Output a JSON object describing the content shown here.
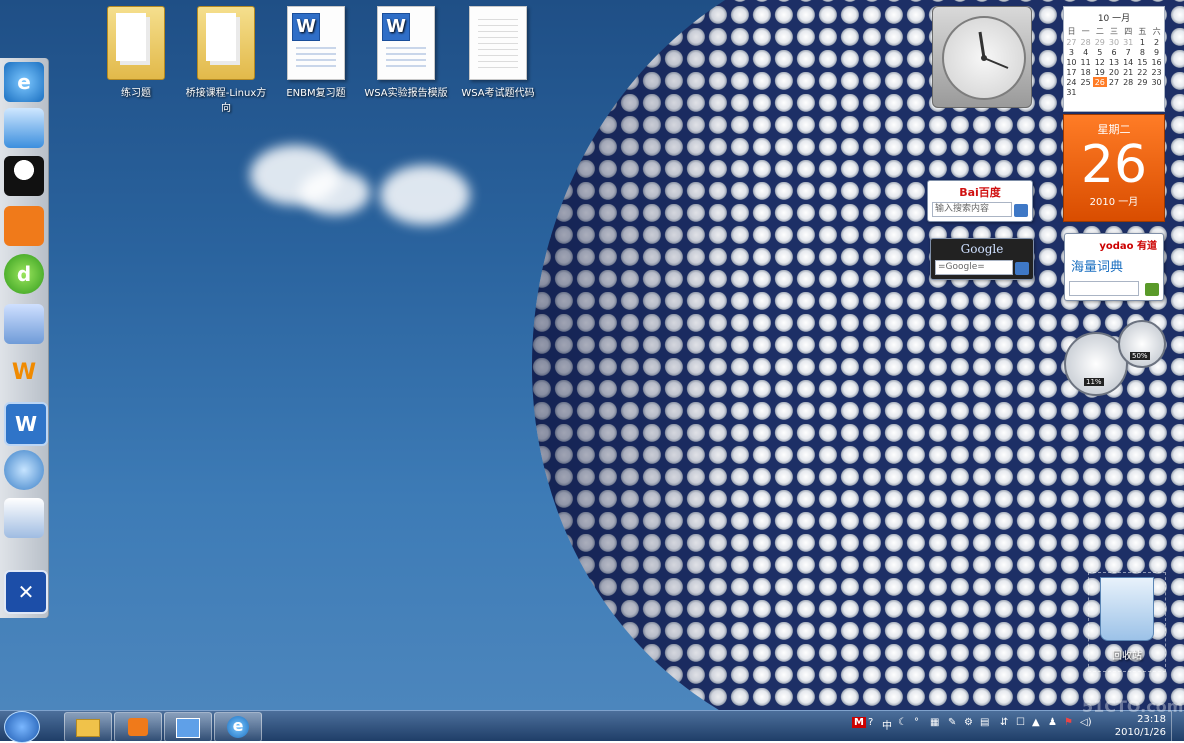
{
  "desktop": {
    "icons": [
      {
        "label": "练习题",
        "type": "folder"
      },
      {
        "label": "桥接课程-Linux方向",
        "type": "folder"
      },
      {
        "label": "ENBM复习题",
        "type": "word"
      },
      {
        "label": "WSA实验报告模版",
        "type": "word"
      },
      {
        "label": "WSA考试题代码",
        "type": "text"
      }
    ],
    "recycle_bin": {
      "label": "回收站"
    }
  },
  "dock": {
    "items": [
      "ie-icon",
      "monitor-icon",
      "qq-icon",
      "mail-icon",
      "music-icon",
      "notepad-icon",
      "wo-icon",
      "word-icon",
      "search-icon",
      "paint-icon",
      "tools-icon"
    ]
  },
  "gadgets": {
    "calendar": {
      "month_header": "10 一月",
      "weekdays": [
        "日",
        "一",
        "二",
        "三",
        "四",
        "五",
        "六"
      ],
      "weeks": [
        [
          "27",
          "28",
          "29",
          "30",
          "31",
          "1",
          "2"
        ],
        [
          "3",
          "4",
          "5",
          "6",
          "7",
          "8",
          "9"
        ],
        [
          "10",
          "11",
          "12",
          "13",
          "14",
          "15",
          "16"
        ],
        [
          "17",
          "18",
          "19",
          "20",
          "21",
          "22",
          "23"
        ],
        [
          "24",
          "25",
          "26",
          "27",
          "28",
          "29",
          "30"
        ],
        [
          "31",
          "",
          "",
          "",
          "",
          "",
          ""
        ]
      ],
      "weekday_label": "星期二",
      "day": "26",
      "year_month": "2010 一月"
    },
    "baidu": {
      "logo": "Bai百度",
      "placeholder": "输入搜索内容"
    },
    "google": {
      "logo": "Google",
      "placeholder": "=Google="
    },
    "youdao": {
      "logo": "yodao 有道",
      "title": "海量词典"
    },
    "cpu_meter": {
      "cpu_label": "11%",
      "memory_label": "50%"
    }
  },
  "taskbar": {
    "time": "23:18",
    "date": "2010/1/26",
    "ime_label": "中",
    "watermark": "51CTO.com"
  }
}
